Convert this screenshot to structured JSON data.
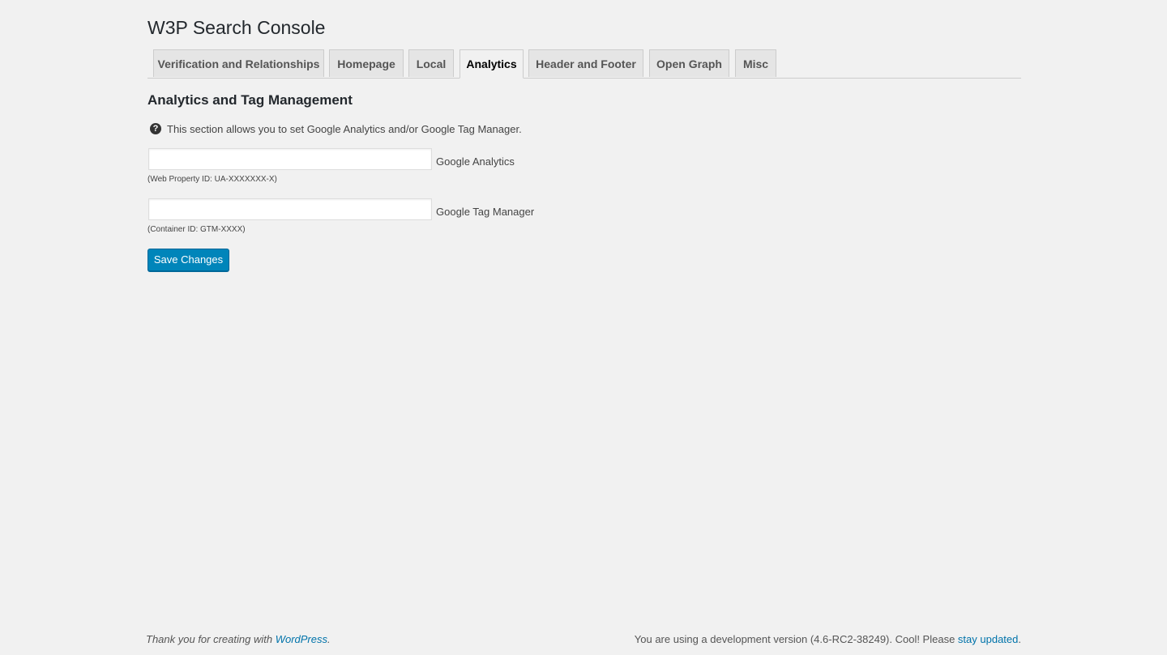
{
  "page": {
    "title": "W3P Search Console"
  },
  "tabs": [
    {
      "label": "Verification and Relationships",
      "active": false
    },
    {
      "label": "Homepage",
      "active": false
    },
    {
      "label": "Local",
      "active": false
    },
    {
      "label": "Analytics",
      "active": true
    },
    {
      "label": "Header and Footer",
      "active": false
    },
    {
      "label": "Open Graph",
      "active": false
    },
    {
      "label": "Misc",
      "active": false
    }
  ],
  "section": {
    "title": "Analytics and Tag Management",
    "help_icon": "question-circle-icon",
    "help_text": "This section allows you to set Google Analytics and/or Google Tag Manager."
  },
  "fields": {
    "google_analytics": {
      "value": "",
      "label": "Google Analytics",
      "description": "(Web Property ID: UA-XXXXXXX-X)"
    },
    "google_tag_manager": {
      "value": "",
      "label": "Google Tag Manager",
      "description": "(Container ID: GTM-XXXX)"
    }
  },
  "actions": {
    "save_label": "Save Changes"
  },
  "footer": {
    "thanks_text": "Thank you for creating with ",
    "thanks_link": "WordPress",
    "thanks_suffix": ".",
    "version_text": "You are using a development version (4.6-RC2-38249). Cool! Please ",
    "version_link": "stay updated",
    "version_suffix": "."
  },
  "colors": {
    "background": "#f1f1f1",
    "primary_button": "#0085ba",
    "link": "#0073aa",
    "tab_inactive": "#e5e5e5"
  }
}
